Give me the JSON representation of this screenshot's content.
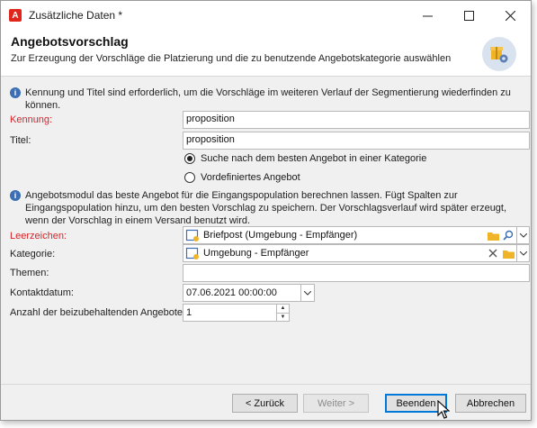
{
  "window": {
    "title": "Zusätzliche Daten *",
    "app_icon": "A"
  },
  "controls": {
    "minimize": "—",
    "maximize": "☐",
    "close": "✕"
  },
  "header": {
    "title": "Angebotsvorschlag",
    "subtitle": "Zur Erzeugung der Vorschläge die Platzierung und die zu benutzende Angebotskategorie auswählen"
  },
  "info1": {
    "icon": "i",
    "text": "Kennung und Titel sind erforderlich, um die Vorschläge im weiteren Verlauf der Segmentierung wiederfinden zu können."
  },
  "fields": {
    "kennung_label": "Kennung:",
    "kennung_value": "proposition",
    "titel_label": "Titel:",
    "titel_value": "proposition"
  },
  "radios": {
    "option1": "Suche nach dem besten Angebot in einer Kategorie",
    "option2": "Vordefiniertes Angebot",
    "selected": "option1"
  },
  "info2": {
    "icon": "i",
    "text": "Angebotsmodul das beste Angebot für die Eingangspopulation berechnen lassen. Fügt Spalten zur Eingangspopulation hinzu, um den besten Vorschlag zu speichern. Der Vorschlagsverlauf wird später erzeugt, wenn der Vorschlag in einem Versand benutzt wird."
  },
  "form": {
    "leerzeichen_label": "Leerzeichen:",
    "leerzeichen_value": "Briefpost (Umgebung - Empfänger)",
    "kategorie_label": "Kategorie:",
    "kategorie_value": "Umgebung - Empfänger",
    "themen_label": "Themen:",
    "themen_value": "",
    "kontaktdatum_label": "Kontaktdatum:",
    "kontaktdatum_value": "07.06.2021 00:00:00",
    "anzahl_label": "Anzahl der beizubehaltenden Angebote:",
    "anzahl_value": "1"
  },
  "buttons": {
    "back": "< Zurück",
    "next": "Weiter >",
    "finish": "Beenden",
    "cancel": "Abbrechen"
  },
  "colors": {
    "required": "#d8232a",
    "accent": "#0078d7",
    "info": "#3c6eb4",
    "folder": "#f0b429"
  }
}
